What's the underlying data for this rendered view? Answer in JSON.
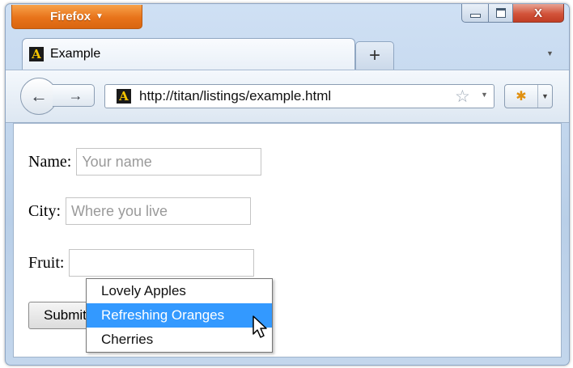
{
  "window": {
    "firefox_button": "Firefox",
    "controls": {
      "minimize": "minimize",
      "maximize": "maximize",
      "close": "close"
    }
  },
  "tab": {
    "title": "Example",
    "site_icon_letter": "A",
    "new_tab": "+"
  },
  "navbar": {
    "back": "←",
    "forward": "→",
    "url": "http://titan/listings/example.html",
    "star": "☆"
  },
  "form": {
    "name_label": "Name:",
    "name_placeholder": "Your name",
    "city_label": "City:",
    "city_placeholder": "Where you live",
    "fruit_label": "Fruit:",
    "fruit_value": "",
    "submit_label": "Submit"
  },
  "dropdown": {
    "options": [
      "Lovely Apples",
      "Refreshing Oranges",
      "Cherries"
    ],
    "highlighted": "Refreshing Oranges",
    "highlight_color": "#3399ff"
  },
  "icons": {
    "site": "site-favicon-icon",
    "star": "bookmark-star-icon",
    "addon": "addon-icon",
    "cursor": "mouse-pointer-icon"
  }
}
